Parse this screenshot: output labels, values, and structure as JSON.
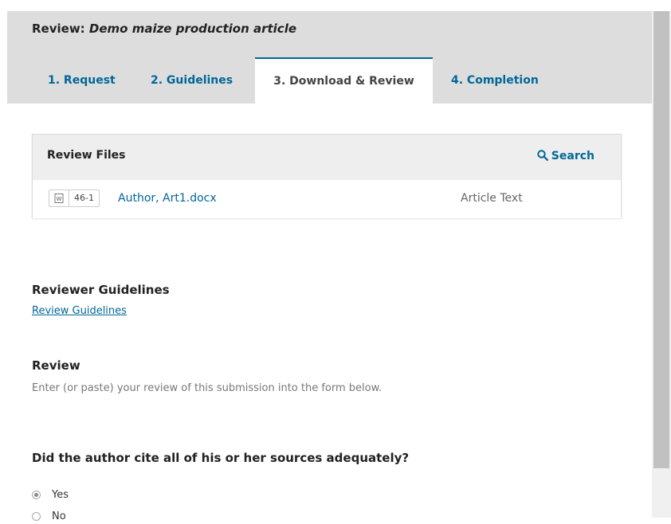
{
  "header": {
    "title_prefix": "Review: ",
    "title_italic": "Demo maize production article",
    "tabs": [
      {
        "label": "1. Request"
      },
      {
        "label": "2. Guidelines"
      },
      {
        "label": "3. Download & Review"
      },
      {
        "label": "4. Completion"
      }
    ],
    "active_tab": "3. Download & Review"
  },
  "review_files": {
    "title": "Review Files",
    "search_label": "Search",
    "files": [
      {
        "id": "46-1",
        "name": "Author, Art1.docx",
        "type": "Article Text",
        "icon": "word-document-icon"
      }
    ]
  },
  "guidelines": {
    "heading": "Reviewer Guidelines",
    "link_label": "Review Guidelines"
  },
  "review": {
    "heading": "Review",
    "description": "Enter (or paste) your review of this submission into the form below."
  },
  "question": {
    "text": "Did the author cite all of his or her sources adequately?",
    "options": [
      {
        "label": "Yes",
        "checked": true
      },
      {
        "label": "No",
        "checked": false
      }
    ]
  },
  "colors": {
    "accent": "#006798",
    "header_bg": "#dddddd",
    "panel_head_bg": "#eeeeee"
  }
}
